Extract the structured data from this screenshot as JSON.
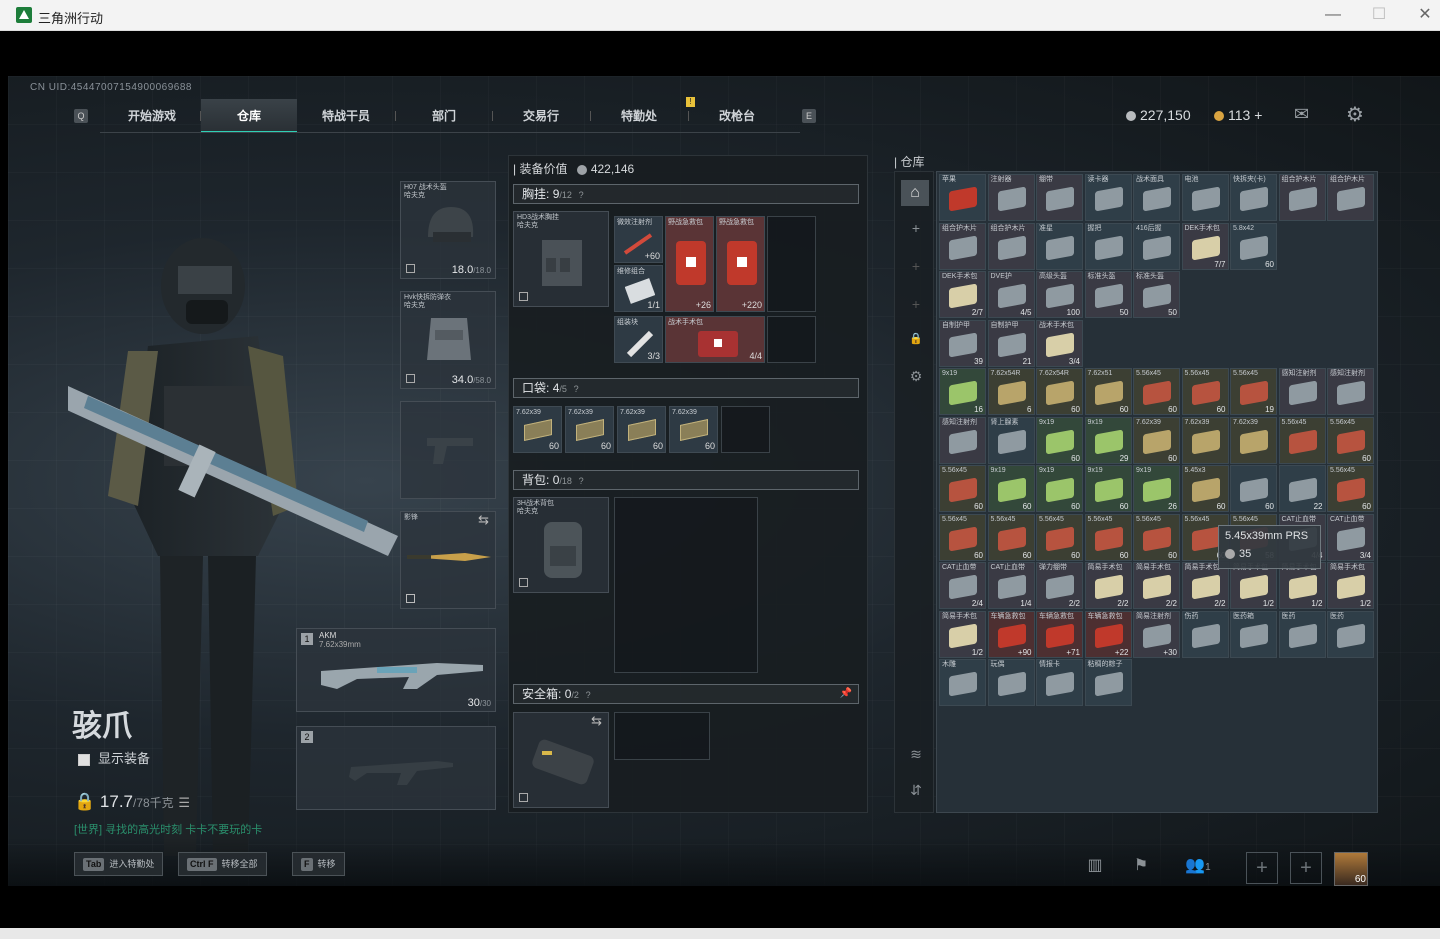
{
  "window": {
    "title": "三角洲行动",
    "min": "—",
    "max": "☐",
    "close": "✕"
  },
  "uid": "CN UID:4544700715490006968​8",
  "nav": {
    "key_left": "Q",
    "key_right": "E",
    "tabs": [
      "开始游戏",
      "仓库",
      "特战干员",
      "部门",
      "交易行",
      "特勤处",
      "改枪台"
    ],
    "active": 1,
    "badge": "!"
  },
  "currency": {
    "coins": "227,150",
    "coins_color": "#c9c9c9",
    "coupons": "113",
    "coupons_plus": "+",
    "coupon_color": "#d9a441"
  },
  "operator": {
    "name": "骇爪",
    "show_equip": "显示装备",
    "weight": "17.7",
    "weight_max": "/78千克",
    "chat": "[世界] 寻找的高光时刻 卡卡不要玩的卡"
  },
  "gear": {
    "helmet": {
      "label": "H07 战术头盔\n哈夫克",
      "value": "18.0",
      "max": "/18.0"
    },
    "armor": {
      "label": "Hvk快拆防弹衣\n哈夫克",
      "value": "34.0",
      "max": "/58.0"
    },
    "melee": {
      "label": "影锋"
    },
    "primary": {
      "slot": "1",
      "name": "AKM",
      "ammo_type": "7.62x39mm",
      "ammo": "30",
      "ammo_max": "/30"
    },
    "secondary": {
      "slot": "2"
    }
  },
  "equip": {
    "value_label": "装备价值",
    "value": "422,146",
    "rig": {
      "title": "胸挂:",
      "count": "9",
      "cap": "/12",
      "q": "?",
      "label": "HD3战术胸挂\n哈夫克",
      "items": [
        {
          "label": "微效注射剂",
          "num": "+60"
        },
        {
          "label": "野战急救包",
          "num": "+26"
        },
        {
          "label": "野战急救包",
          "num": "+220"
        },
        {
          "label": "维修组合",
          "num": "1/1"
        },
        {
          "label": "组装块",
          "num": "3/3"
        },
        {
          "label": "战术手术包",
          "num": "4/4"
        }
      ]
    },
    "pocket": {
      "title": "口袋:",
      "count": "4",
      "cap": "/5",
      "q": "?",
      "items": [
        {
          "label": "7.62x39",
          "num": "60"
        },
        {
          "label": "7.62x39",
          "num": "60"
        },
        {
          "label": "7.62x39",
          "num": "60"
        },
        {
          "label": "7.62x39",
          "num": "60"
        }
      ]
    },
    "bag": {
      "title": "背包:",
      "count": "0",
      "cap": "/18",
      "q": "?",
      "label": "3H战术背包\n哈夫克"
    },
    "safe": {
      "title": "安全箱:",
      "count": "0",
      "cap": "/2",
      "q": "?"
    }
  },
  "storage": {
    "title": "仓库",
    "rows": [
      [
        {
          "l": "苹果",
          "n": ""
        },
        {
          "l": "注射器",
          "n": ""
        },
        {
          "l": "绷带",
          "n": ""
        },
        {
          "l": "读卡器",
          "n": ""
        },
        {
          "l": "战术面具",
          "n": ""
        },
        {
          "l": "电池",
          "n": ""
        },
        {
          "l": "快拆夹(卡)",
          "n": ""
        },
        {
          "l": "组合护木片",
          "n": ""
        },
        {
          "l": "组合护木片",
          "n": ""
        }
      ],
      [
        {
          "l": "组合护木片",
          "n": ""
        },
        {
          "l": "组合护木片",
          "n": ""
        },
        {
          "l": "准星",
          "n": ""
        },
        {
          "l": "握把",
          "n": ""
        },
        {
          "l": "416后握",
          "n": ""
        },
        {
          "l": "DEK手术包",
          "n": "7/7"
        },
        {
          "l": "5.8x42",
          "n": "60"
        }
      ],
      [
        {
          "l": "DEK手术包",
          "n": "2/7"
        },
        {
          "l": "DVE护",
          "n": "4/5"
        },
        {
          "l": "高级头盔",
          "n": "100"
        },
        {
          "l": "标准头盔",
          "n": "50"
        },
        {
          "l": "标准头盔",
          "n": "50"
        }
      ],
      [
        {
          "l": "自制护甲",
          "n": "39"
        },
        {
          "l": "自制护甲",
          "n": "21"
        },
        {
          "l": "战术手术包",
          "n": "3/4"
        }
      ],
      [
        {
          "l": "9x19",
          "n": "16"
        },
        {
          "l": "7.62x54R",
          "n": "6"
        },
        {
          "l": "7.62x54R",
          "n": "60"
        },
        {
          "l": "7.62x51",
          "n": "60"
        },
        {
          "l": "5.56x45",
          "n": "60"
        },
        {
          "l": "5.56x45",
          "n": "60"
        },
        {
          "l": "5.56x45",
          "n": "19"
        },
        {
          "l": "感知注射剂",
          "n": ""
        },
        {
          "l": "感知注射剂",
          "n": ""
        }
      ],
      [
        {
          "l": "感知注射剂",
          "n": ""
        },
        {
          "l": "肾上腺素",
          "n": ""
        },
        {
          "l": "9x19",
          "n": "60"
        },
        {
          "l": "9x19",
          "n": "29"
        },
        {
          "l": "7.62x39",
          "n": "60"
        },
        {
          "l": "7.62x39",
          "n": ""
        },
        {
          "l": "7.62x39",
          "n": ""
        },
        {
          "l": "5.56x45",
          "n": ""
        },
        {
          "l": "5.56x45",
          "n": "60"
        }
      ],
      [
        {
          "l": "5.56x45",
          "n": "60"
        },
        {
          "l": "9x19",
          "n": "60"
        },
        {
          "l": "9x19",
          "n": "60"
        },
        {
          "l": "9x19",
          "n": "60"
        },
        {
          "l": "9x19",
          "n": "26"
        },
        {
          "l": "5.45x3",
          "n": "60"
        },
        {
          "l": "",
          "n": "60"
        },
        {
          "l": "",
          "n": "22"
        },
        {
          "l": "5.56x45",
          "n": "60"
        }
      ],
      [
        {
          "l": "5.56x45",
          "n": "60"
        },
        {
          "l": "5.56x45",
          "n": "60"
        },
        {
          "l": "5.56x45",
          "n": "60"
        },
        {
          "l": "5.56x45",
          "n": "60"
        },
        {
          "l": "5.56x45",
          "n": "60"
        },
        {
          "l": "5.56x45",
          "n": "60"
        },
        {
          "l": "5.56x45",
          "n": "58"
        },
        {
          "l": "CAT止血带",
          "n": "4/4"
        },
        {
          "l": "CAT止血带",
          "n": "3/4"
        }
      ],
      [
        {
          "l": "CAT止血带",
          "n": "2/4"
        },
        {
          "l": "CAT止血带",
          "n": "1/4"
        },
        {
          "l": "弹力绷带",
          "n": "2/2"
        },
        {
          "l": "简易手术包",
          "n": "2/2"
        },
        {
          "l": "简易手术包",
          "n": "2/2"
        },
        {
          "l": "简易手术包",
          "n": "2/2"
        },
        {
          "l": "简易手术包",
          "n": "1/2"
        },
        {
          "l": "简易手术包",
          "n": "1/2"
        },
        {
          "l": "简易手术包",
          "n": "1/2"
        }
      ],
      [
        {
          "l": "简易手术包",
          "n": "1/2"
        },
        {
          "l": "车辆急救包",
          "n": "+90"
        },
        {
          "l": "车辆急救包",
          "n": "+71"
        },
        {
          "l": "车辆急救包",
          "n": "+22"
        },
        {
          "l": "简易注射剂",
          "n": "+30"
        },
        {
          "l": "伤药",
          "n": ""
        },
        {
          "l": "医药箱",
          "n": ""
        },
        {
          "l": "医药",
          "n": ""
        },
        {
          "l": "医药",
          "n": ""
        }
      ],
      [
        {
          "l": "木雕",
          "n": ""
        },
        {
          "l": "玩偶",
          "n": ""
        },
        {
          "l": "情报卡",
          "n": ""
        },
        {
          "l": "粘稠的粽子",
          "n": ""
        }
      ]
    ],
    "tooltip": {
      "name": "5.45x39mm PRS",
      "value": "35"
    }
  },
  "hints": [
    {
      "key": "Tab",
      "text": "进入特勤处"
    },
    {
      "key": "Ctrl F",
      "text": "转移全部"
    },
    {
      "key": "F",
      "text": "转移"
    }
  ],
  "friends": {
    "count": "1"
  },
  "player": {
    "level": "60"
  }
}
